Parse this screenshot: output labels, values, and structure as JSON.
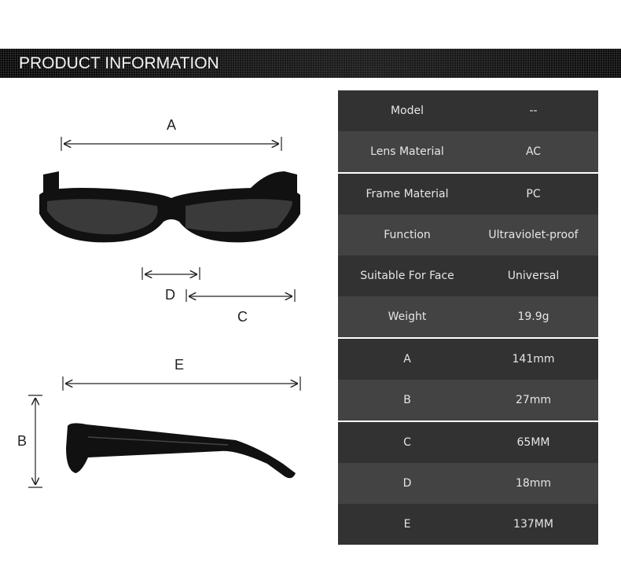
{
  "banner": {
    "title": "PRODUCT INFORMATION"
  },
  "dimension_labels": {
    "A": "A",
    "B": "B",
    "C": "C",
    "D": "D",
    "E": "E"
  },
  "specs": [
    {
      "key": "Model",
      "value": "--"
    },
    {
      "key": "Lens Material",
      "value": "AC"
    },
    {
      "key": "Frame Material",
      "value": "PC"
    },
    {
      "key": "Function",
      "value": "Ultraviolet-proof"
    },
    {
      "key": "Suitable For Face",
      "value": "Universal"
    },
    {
      "key": "Weight",
      "value": "19.9g"
    },
    {
      "key": "A",
      "value": "141mm"
    },
    {
      "key": "B",
      "value": "27mm"
    },
    {
      "key": "C",
      "value": "65MM"
    },
    {
      "key": "D",
      "value": "18mm"
    },
    {
      "key": "E",
      "value": "137MM"
    }
  ],
  "colors": {
    "row_dark": "#323232",
    "row_light": "#434343",
    "frame": "#111111"
  }
}
